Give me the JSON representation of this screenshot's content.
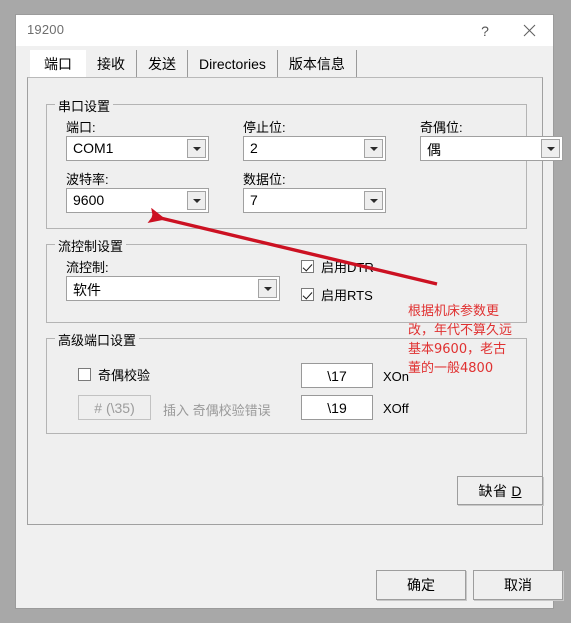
{
  "window": {
    "title": "19200",
    "help_button": "?",
    "close_button": "✕"
  },
  "tabs": [
    {
      "label": "端口",
      "active": true
    },
    {
      "label": "接收",
      "active": false
    },
    {
      "label": "发送",
      "active": false
    },
    {
      "label": "Directories",
      "active": false
    },
    {
      "label": "版本信息",
      "active": false
    }
  ],
  "serial_group": {
    "title": "串口设置",
    "port_label": "端口:",
    "port_value": "COM1",
    "stopbits_label": "停止位:",
    "stopbits_value": "2",
    "parity_label": "奇偶位:",
    "parity_value": "偶",
    "baud_label": "波特率:",
    "baud_value": "9600",
    "databits_label": "数据位:",
    "databits_value": "7"
  },
  "flow_group": {
    "title": "流控制设置",
    "flow_label": "流控制:",
    "flow_value": "软件",
    "dtr_label": "启用DTR",
    "dtr_checked": true,
    "rts_label": "启用RTS",
    "rts_checked": true
  },
  "advanced_group": {
    "title": "高级端口设置",
    "parity_check_label": "奇偶校验",
    "parity_check_checked": false,
    "parity_error_value": "# (\\35)",
    "parity_error_label": "插入 奇偶校验错误",
    "xon_value": "\\17",
    "xon_label": "XOn",
    "xoff_value": "\\19",
    "xoff_label": "XOff"
  },
  "buttons": {
    "default_text": "缺省",
    "default_accel": "D",
    "ok": "确定",
    "cancel": "取消"
  },
  "annotation": {
    "line1": "根据机床参数更",
    "line2": "改，年代不算久远",
    "line3": "基本9600，老古",
    "line4": "董的一般4800",
    "color": "#e03131"
  }
}
